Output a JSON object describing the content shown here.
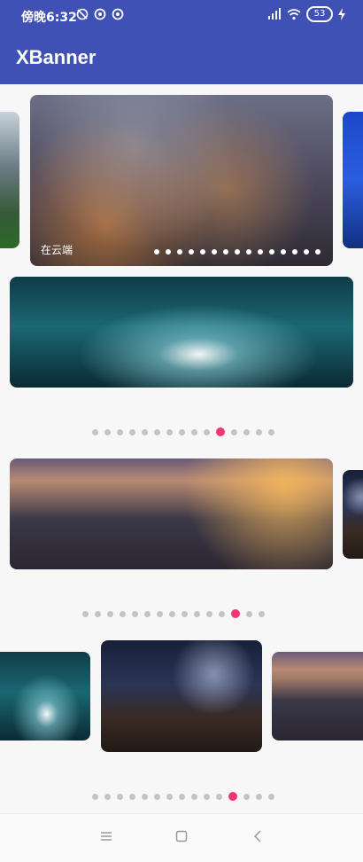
{
  "status_bar": {
    "time": "傍晚6:32",
    "battery": "53",
    "left_icons": [
      "do-not-disturb-icon",
      "notification-icon",
      "notification-icon"
    ],
    "right_icons": [
      "signal-icon",
      "wifi-icon",
      "battery-icon",
      "charging-icon"
    ]
  },
  "app_bar": {
    "title": "XBanner"
  },
  "banners": [
    {
      "caption": "在云端",
      "indicator_count": 15
    },
    {
      "indicator_count": 15,
      "active_index": 10
    },
    {
      "indicator_count": 15,
      "active_index": 12
    },
    {
      "indicator_count": 15,
      "active_index": 11
    }
  ],
  "nav_bar": {
    "buttons": [
      "menu-icon",
      "home-icon",
      "back-icon"
    ]
  }
}
